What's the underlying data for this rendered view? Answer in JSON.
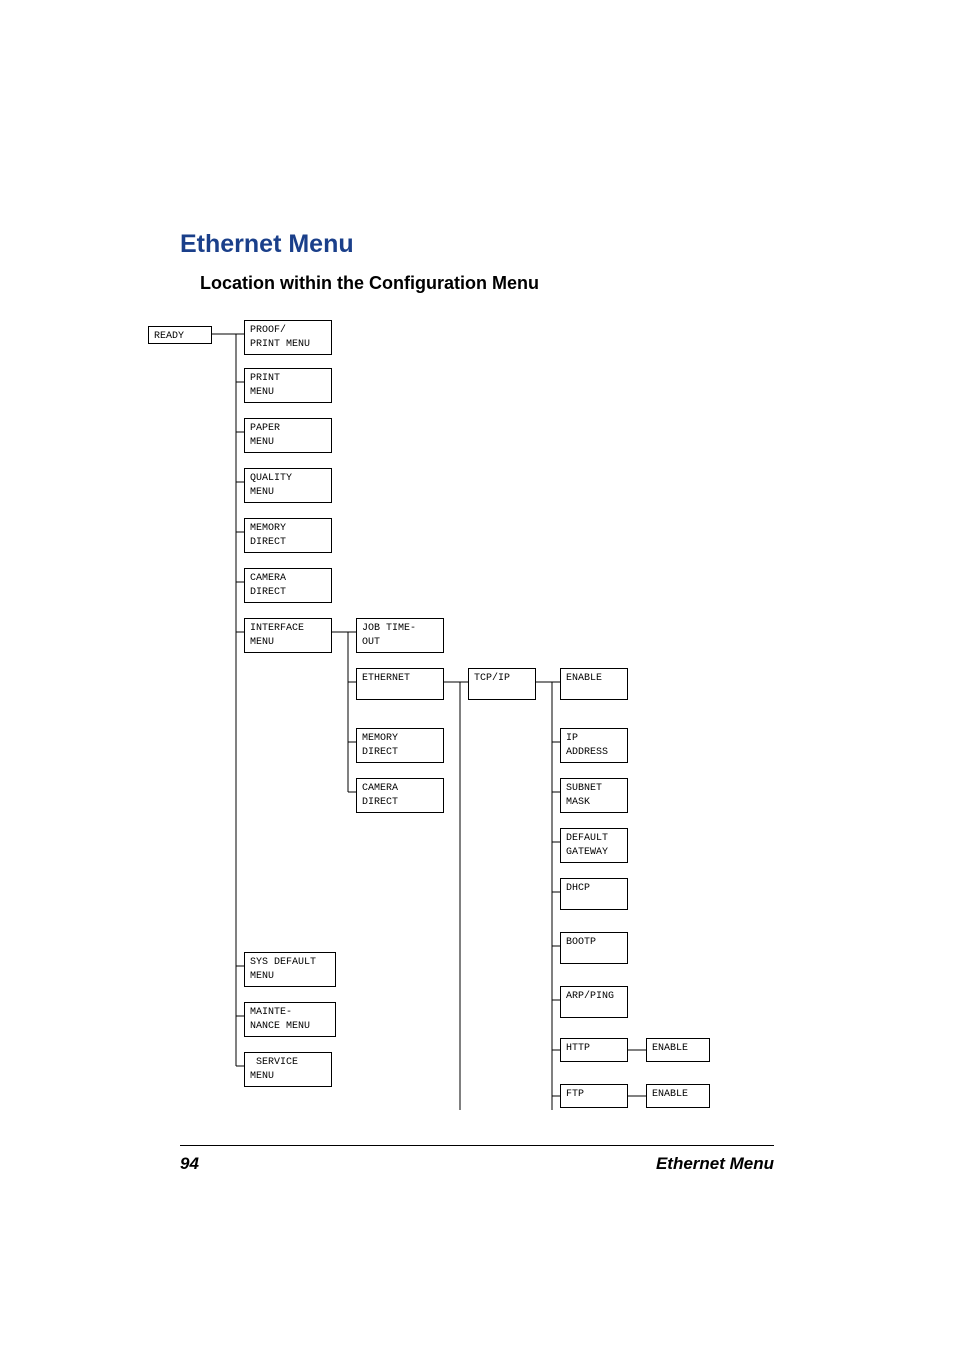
{
  "title": "Ethernet Menu",
  "subtitle": "Location within the Configuration Menu",
  "footer": {
    "page": "94",
    "section": "Ethernet Menu"
  },
  "boxes": {
    "ready": "READY",
    "proof": "PROOF/\nPRINT MENU",
    "print": "PRINT\nMENU",
    "paper": "PAPER\nMENU",
    "quality": "QUALITY\nMENU",
    "memory": "MEMORY\nDIRECT",
    "camera": "CAMERA\nDIRECT",
    "interface": "INTERFACE\nMENU",
    "sysdefault": "SYS DEFAULT\nMENU",
    "maint": "MAINTE-\nNANCE MENU",
    "service": " SERVICE\nMENU",
    "jobtimeout": "JOB TIME-\nOUT",
    "ethernet": "ETHERNET",
    "memory2": "MEMORY\nDIRECT",
    "camera2": "CAMERA\nDIRECT",
    "tcpip": "TCP/IP",
    "enable": "ENABLE",
    "ipaddr": "IP\nADDRESS",
    "subnet": "SUBNET\nMASK",
    "gateway": "DEFAULT\nGATEWAY",
    "dhcp": "DHCP",
    "bootp": "BOOTP",
    "arpping": "ARP/PING",
    "http": "HTTP",
    "ftp": "FTP",
    "enable2": "ENABLE",
    "enable3": "ENABLE"
  }
}
